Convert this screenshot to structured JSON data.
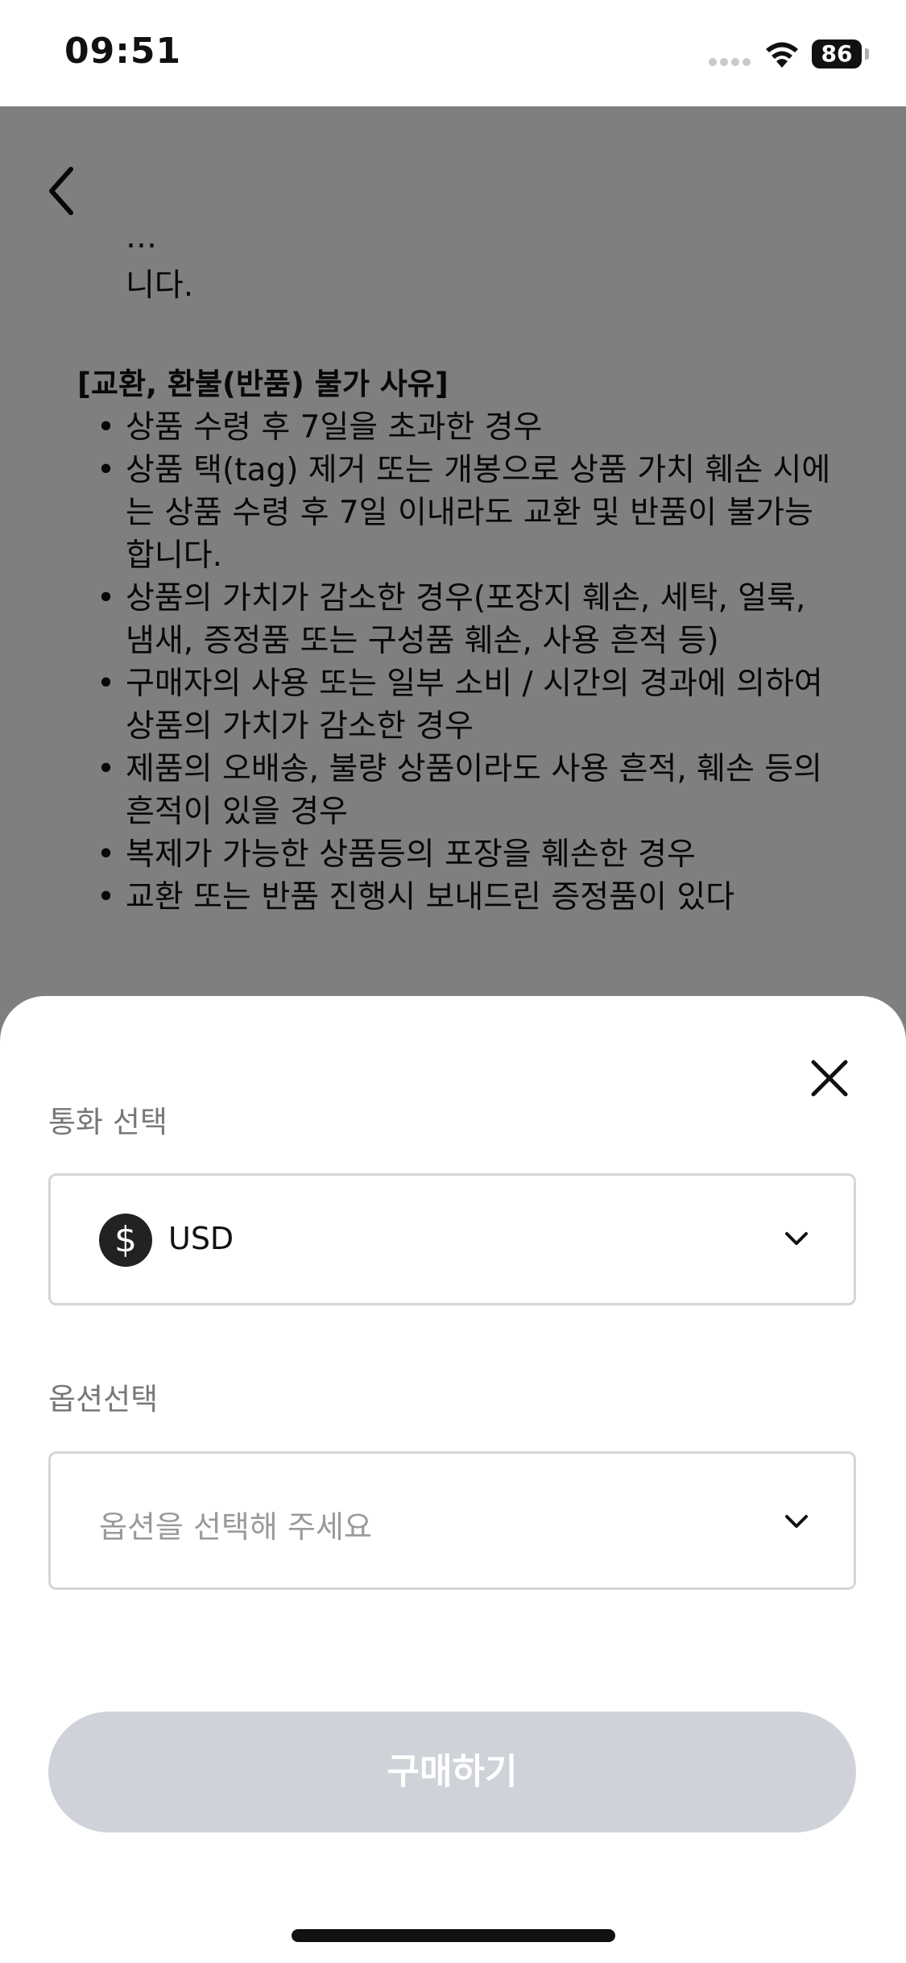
{
  "status_bar": {
    "time": "09:51",
    "battery": "86"
  },
  "page": {
    "fragment_top": "…",
    "fragment_line": "니다.",
    "section_title": "[교환, 환불(반품) 불가 사유]",
    "bullets": [
      "상품 수령 후 7일을 초과한 경우",
      "상품 택(tag) 제거 또는 개봉으로 상품 가치 훼손 시에는 상품 수령 후 7일 이내라도 교환 및 반품이 불가능합니다.",
      "상품의 가치가 감소한 경우(포장지 훼손, 세탁, 얼룩, 냄새, 증정품 또는 구성품 훼손, 사용 흔적 등)",
      "구매자의 사용 또는 일부 소비 / 시간의 경과에 의하여 상품의 가치가 감소한 경우",
      "제품의 오배송, 불량 상품이라도 사용 흔적, 훼손 등의 흔적이 있을 경우",
      "복제가 가능한 상품등의 포장을 훼손한 경우",
      "교환 또는 반품 진행시 보내드린 증정품이 있다"
    ]
  },
  "sheet": {
    "currency_label": "통화 선택",
    "currency_symbol": "$",
    "currency_value": "USD",
    "option_label": "옵션선택",
    "option_placeholder": "옵션을 선택해 주세요",
    "buy_label": "구매하기"
  },
  "colors": {
    "scrim": "#000000",
    "button_disabled": "#cfd3d9",
    "label_text": "#777777"
  },
  "icons": [
    "back-chevron-icon",
    "close-icon",
    "dollar-icon",
    "chevron-down-icon",
    "wifi-icon"
  ]
}
